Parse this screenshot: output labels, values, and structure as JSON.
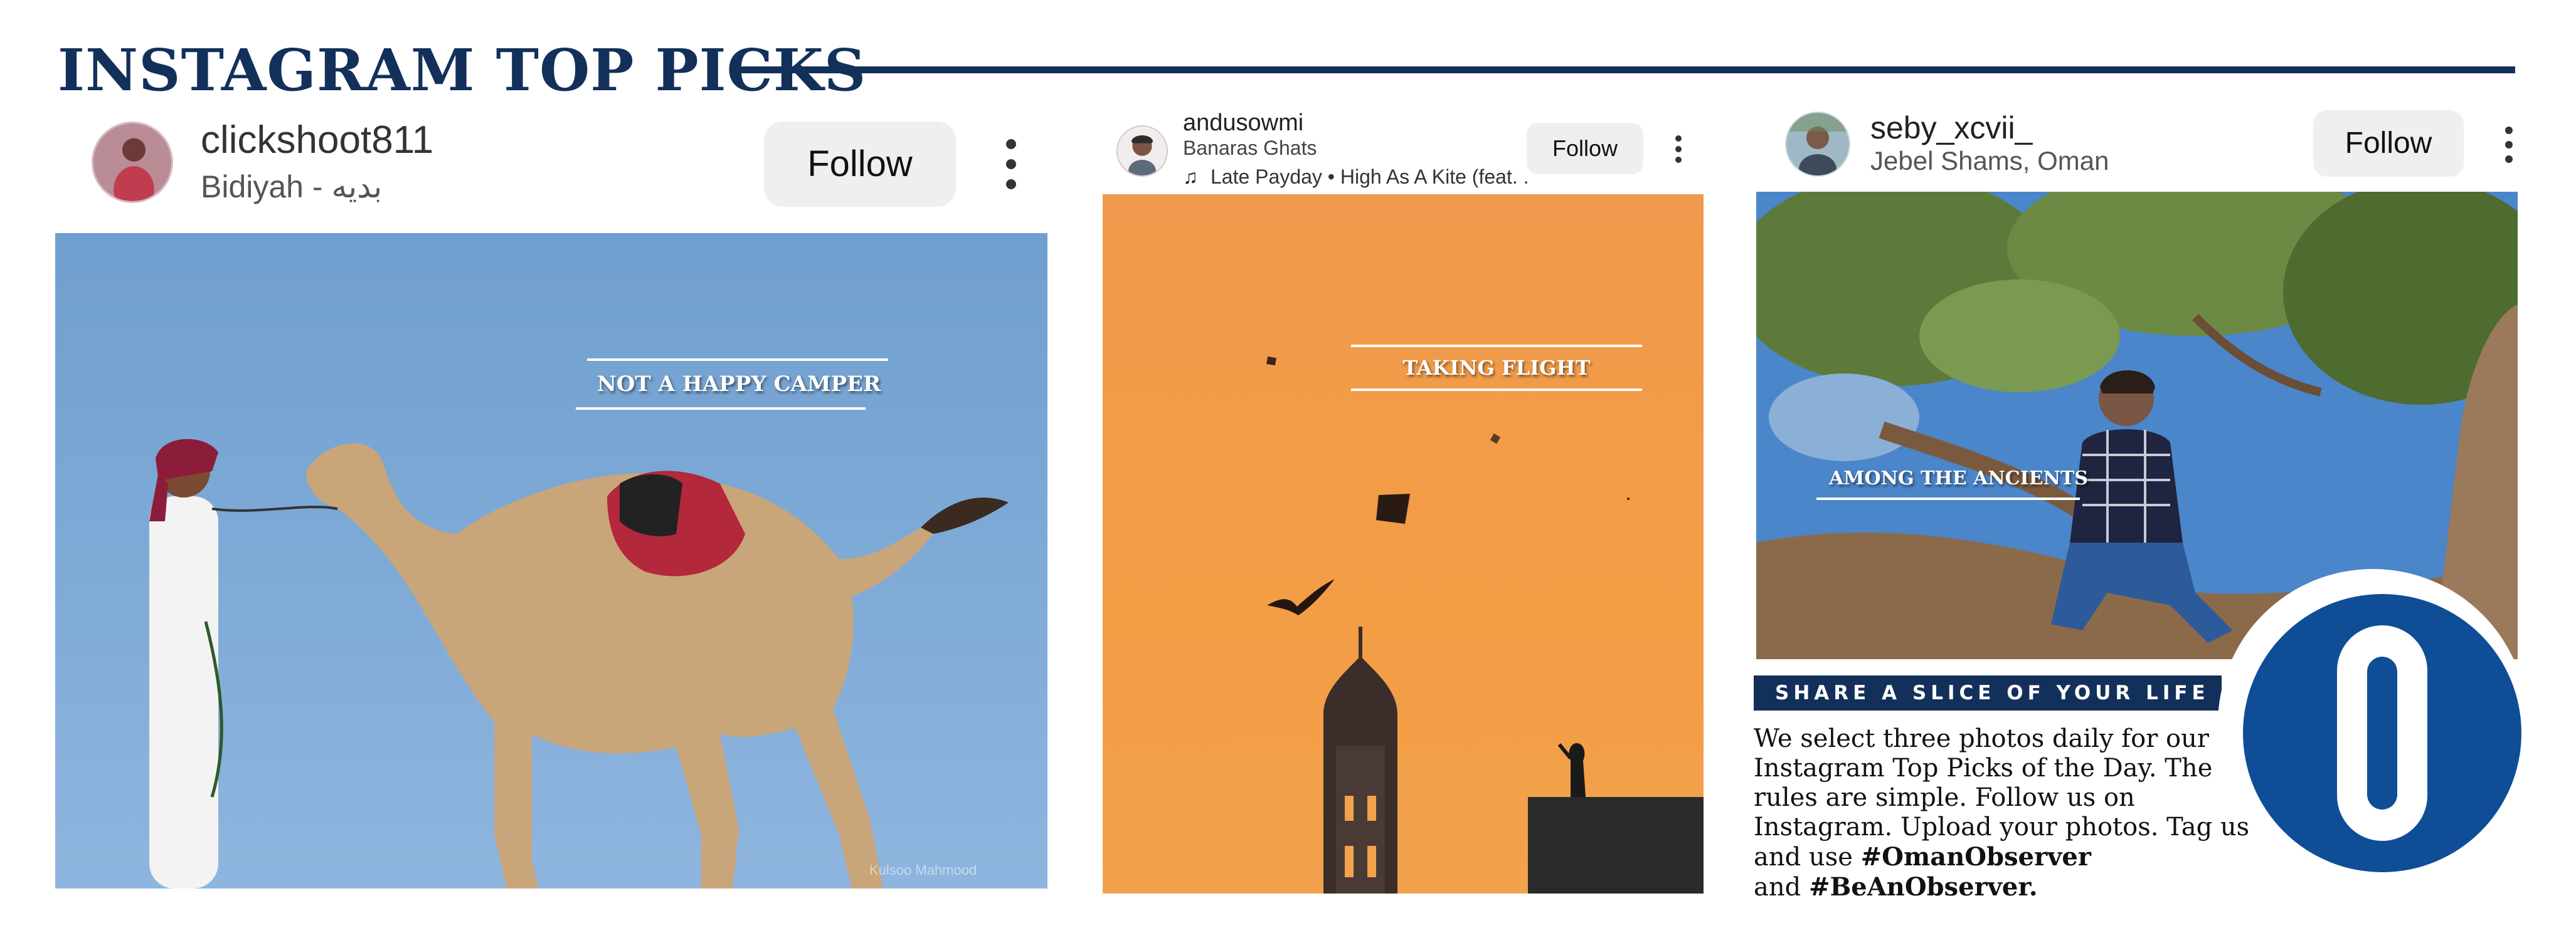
{
  "page": {
    "title": "INSTAGRAM TOP PICKS",
    "accent_color": "#12305a"
  },
  "posts": [
    {
      "username": "clickshoot811",
      "location": "Bidiyah - بديه",
      "follow_label": "Follow",
      "caption": "NOT A HAPPY CAMPER",
      "photo_credit": "Kulsoo Mahmood",
      "more_icon": "more-vertical-icon"
    },
    {
      "username": "andusowmi",
      "location": "Banaras Ghats",
      "audio": "Late Payday • High As A Kite (feat. ...",
      "audio_icon": "music-note-icon",
      "follow_label": "Follow",
      "caption": "TAKING FLIGHT",
      "more_icon": "more-vertical-icon"
    },
    {
      "username": "seby_xcvii_",
      "location": "Jebel Shams, Oman",
      "follow_label": "Follow",
      "caption": "AMONG THE  ANCIENTS",
      "more_icon": "more-vertical-icon"
    }
  ],
  "promo": {
    "banner": "SHARE A SLICE OF YOUR LIFE",
    "body_text": "We select three photos daily for our Instagram Top Picks of the Day. The rules are simple. Follow us on Instagram. Upload your photos. Tag us and use",
    "hashtag1": "#OmanObserver",
    "and_word": "and",
    "hashtag2": "#BeAnObserver.",
    "logo_color": "#0f4e96"
  }
}
